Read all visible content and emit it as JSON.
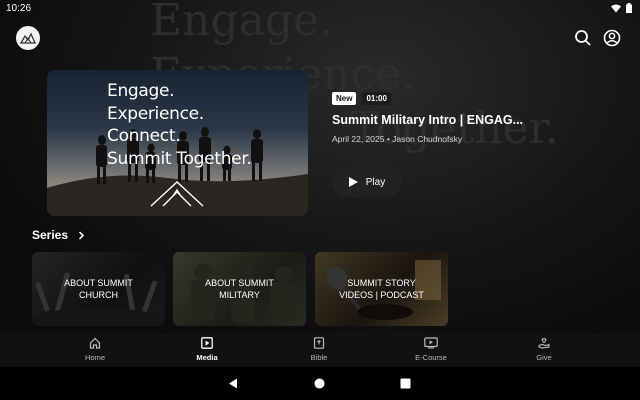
{
  "status_bar": {
    "time": "10:26"
  },
  "background_text": [
    "Engage.",
    "Experience.",
    "",
    "Together."
  ],
  "hero": {
    "image_lines": [
      "Engage.",
      "Experience.",
      "Connect.",
      "Summit Together."
    ],
    "badge_new": "New",
    "duration": "01:00",
    "title": "Summit Military Intro | ENGAG...",
    "subtitle": "April 22, 2025 • Jason Chudnofsky",
    "play_label": "Play"
  },
  "series": {
    "heading": "Series",
    "cards": [
      {
        "label": "ABOUT SUMMIT CHURCH"
      },
      {
        "label": "ABOUT SUMMIT MILITARY"
      },
      {
        "label": "SUMMIT STORY VIDEOS | PODCAST"
      }
    ]
  },
  "bottom_nav": {
    "items": [
      {
        "label": "Home",
        "icon": "home-icon",
        "active": false
      },
      {
        "label": "Media",
        "icon": "media-icon",
        "active": true
      },
      {
        "label": "Bible",
        "icon": "bible-icon",
        "active": false
      },
      {
        "label": "E-Course",
        "icon": "ecourse-icon",
        "active": false
      },
      {
        "label": "Give",
        "icon": "give-icon",
        "active": false
      }
    ]
  },
  "colors": {
    "background": "#0d0d0d",
    "accent": "#ffffff",
    "nav_bg": "#111111"
  }
}
